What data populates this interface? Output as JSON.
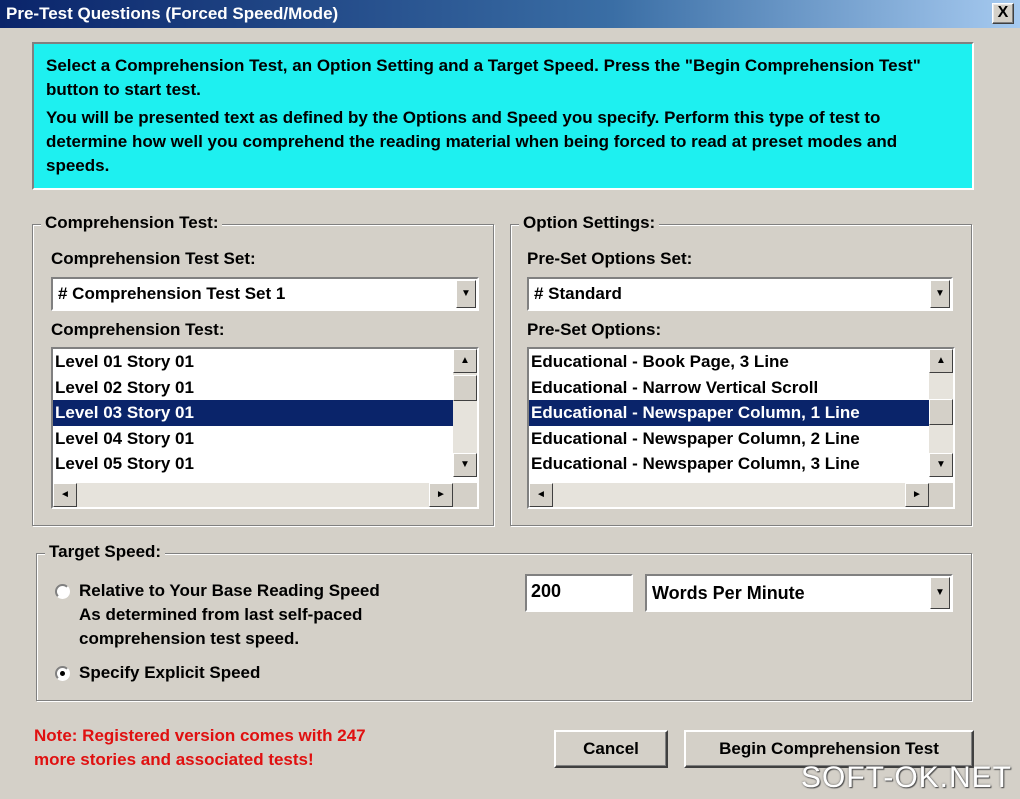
{
  "window": {
    "title": "Pre-Test Questions (Forced Speed/Mode)",
    "close_label": "X"
  },
  "instructions": {
    "line1": "Select a Comprehension Test, an Option Setting and a Target Speed.  Press the \"Begin Comprehension Test\" button to start test.",
    "line2": "You will be presented text as defined by the Options and Speed you specify.  Perform this type of test to determine how well you comprehend the reading material when being forced to read at preset modes and speeds."
  },
  "comprehension": {
    "group_title": "Comprehension Test:",
    "set_label": "Comprehension Test Set:",
    "set_value": "# Comprehension Test Set 1",
    "test_label": "Comprehension Test:",
    "items": [
      "Level 01 Story 01",
      "Level 02 Story 01",
      "Level 03 Story 01",
      "Level 04 Story 01",
      "Level 05 Story 01"
    ],
    "selected_index": 2
  },
  "options": {
    "group_title": "Option Settings:",
    "set_label": "Pre-Set Options Set:",
    "set_value": "# Standard",
    "list_label": "Pre-Set Options:",
    "items": [
      "Educational - Book Page, 3 Line",
      "Educational - Narrow Vertical Scroll",
      "Educational - Newspaper Column, 1 Line",
      "Educational - Newspaper Column, 2 Line",
      "Educational - Newspaper Column, 3 Line"
    ],
    "selected_index": 2
  },
  "target_speed": {
    "group_title": "Target Speed:",
    "relative_label": "Relative to Your Base Reading Speed",
    "relative_desc1": "As determined from last self-paced",
    "relative_desc2": "comprehension test speed.",
    "explicit_label": "Specify Explicit Speed",
    "selected": "explicit",
    "speed_value": "200",
    "unit_value": "Words Per Minute"
  },
  "note": {
    "line1": "Note: Registered version comes with 247",
    "line2": "more stories and associated tests!"
  },
  "buttons": {
    "cancel": "Cancel",
    "begin": "Begin Comprehension Test"
  },
  "icons": {
    "combo_arrow": "▼",
    "scroll_up": "▲",
    "scroll_down": "▼",
    "scroll_left": "◄",
    "scroll_right": "►"
  },
  "watermark": "SOFT-OK.NET",
  "colors": {
    "instruction_bg": "#1ef0f0",
    "selection": "#0a246a",
    "note": "#e01010"
  }
}
